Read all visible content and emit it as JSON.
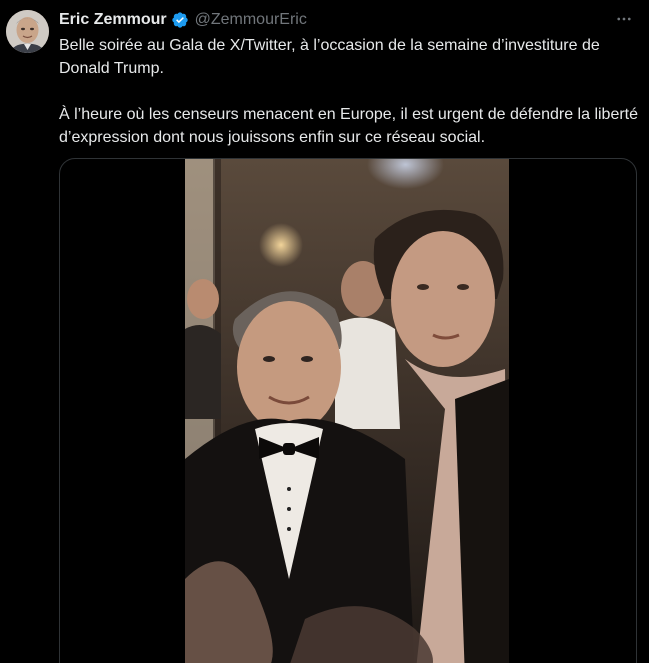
{
  "author": {
    "display_name": "Eric Zemmour",
    "handle": "@ZemmourEric",
    "verified": true,
    "avatar_icon": "avatar-photo"
  },
  "tweet": {
    "paragraphs": [
      "Belle soirée au Gala de X/Twitter, à l’occasion de la semaine d’investiture de Donald Trump.",
      "À l’heure où les censeurs menacent en Europe, il est urgent de défendre la liberté d’expression dont nous jouissons enfin sur ce réseau social."
    ]
  },
  "icons": {
    "verified": "verified-badge-icon",
    "more": "more-options-icon"
  },
  "colors": {
    "background": "#000000",
    "text_primary": "#e7e9ea",
    "text_secondary": "#71767b",
    "verified_blue": "#1d9bf0",
    "border": "#2f3336"
  }
}
